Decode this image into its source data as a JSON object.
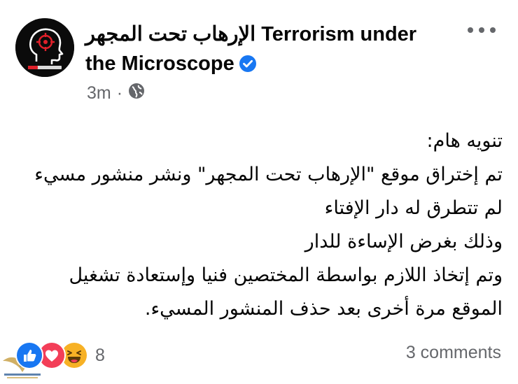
{
  "post": {
    "page_name": "الإرهاب تحت المجهر Terrorism under the Microscope",
    "timestamp": "3m",
    "separator": "·",
    "lines": [
      "تنويه هام:",
      "تم إختراق موقع \"الإرهاب تحت المجهر\" ونشر منشور مسيء",
      "لم تتطرق له دار الإفتاء",
      "وذلك بغرض الإساءة للدار",
      "وتم إتخاذ اللازم بواسطة المختصين فنيا وإستعادة تشغيل",
      "الموقع مرة أخرى بعد حذف المنشور المسيء."
    ],
    "reaction_count": "8",
    "comments_label": "3 comments",
    "icons": {
      "avatar": "terrorism-under-microscope-logo",
      "verified": "verified-badge-icon",
      "privacy": "globe-icon",
      "more": "more-options-icon",
      "reactions": [
        "like-reaction-icon",
        "love-reaction-icon",
        "haha-reaction-icon"
      ]
    },
    "colors": {
      "verified": "#1877f2",
      "like": "#1877f2",
      "love": "#f33e58",
      "haha": "#f7b125",
      "meta_text": "#65676b"
    }
  }
}
